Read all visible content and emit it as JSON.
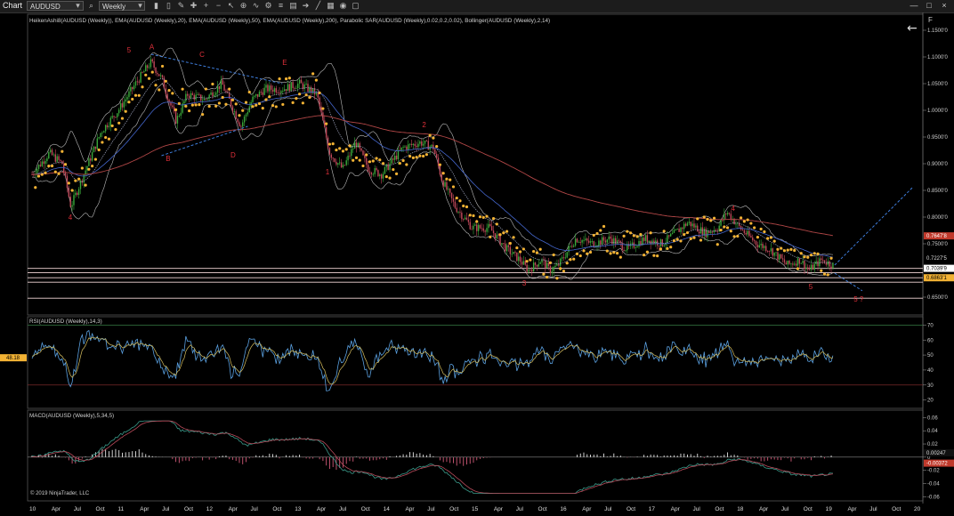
{
  "toolbar": {
    "chart_label": "Chart",
    "instrument": "AUDUSD",
    "period": "Weekly",
    "icons": [
      "search-icon",
      "instrument-dropdown-icon",
      "period-dropdown-icon",
      "bar-chart-icon",
      "candles-icon",
      "draw-icon",
      "crosshair-icon",
      "zoom-in-icon",
      "zoom-out-icon",
      "pointer-icon",
      "plus-icon",
      "indicators-icon",
      "strategy-icon",
      "properties-icon",
      "template-icon",
      "arrow-icon",
      "ruler-icon",
      "grid-icon",
      "eye-icon",
      "window-icon"
    ],
    "window_buttons": [
      "—",
      "□",
      "×"
    ],
    "back_icon": "←",
    "f_button": "F"
  },
  "colors": {
    "background": "#000000",
    "bull": "#3aa83a",
    "bear": "#c0485a",
    "sar": "#f2b234",
    "ema20": "#9aa0b8",
    "ema50": "#4466cc",
    "ema200": "#b04646",
    "boll": "#bbbbbb",
    "hline": "#f4d7d7",
    "rsi_line": "#5aa0e0",
    "rsi_signal": "#d8c060",
    "macd_line": "#3a9a8a",
    "macd_signal": "#b84a5a",
    "wave": "#e0303a",
    "projection": "#3d7bd8"
  },
  "chart_data": [
    {
      "type": "candlestick",
      "title": "HeikenAshi8(AUDUSD (Weekly)), EMA(AUDUSD (Weekly),20), EMA(AUDUSD (Weekly),50), EMA(AUDUSD (Weekly),200), Parabolic SAR(AUDUSD (Weekly),0.02,0.2,0.02), Bollinger(AUDUSD (Weekly),2,14)",
      "ylim": [
        0.62,
        1.18
      ],
      "y_ticks": [
        "1.1500'0",
        "1.1000'0",
        "1.0500'0",
        "1.0000'0",
        "0.9500'0",
        "0.9000'0",
        "0.8500'0",
        "0.8000'0",
        "0.7500'0",
        "0.6500'0"
      ],
      "y_tick_values": [
        1.15,
        1.1,
        1.05,
        1.0,
        0.95,
        0.9,
        0.85,
        0.8,
        0.75,
        0.65
      ],
      "x_ticks": [
        "10",
        "Apr",
        "Jul",
        "Oct",
        "11",
        "Apr",
        "Jul",
        "Oct",
        "12",
        "Apr",
        "Jul",
        "Oct",
        "13",
        "Apr",
        "Jul",
        "Oct",
        "14",
        "Apr",
        "Jul",
        "Oct",
        "15",
        "Apr",
        "Jul",
        "Oct",
        "16",
        "Apr",
        "Jul",
        "Oct",
        "17",
        "Apr",
        "Jul",
        "Oct",
        "18",
        "Apr",
        "Jul",
        "Oct",
        "19",
        "Apr",
        "Jul",
        "Oct",
        "20"
      ],
      "x_start": 2010.0,
      "x_end": 2020.25,
      "series_price": [
        [
          2010.0,
          0.88
        ],
        [
          2010.2,
          0.92
        ],
        [
          2010.35,
          0.9
        ],
        [
          2010.45,
          0.82
        ],
        [
          2010.6,
          0.88
        ],
        [
          2010.8,
          0.96
        ],
        [
          2011.0,
          1.0
        ],
        [
          2011.2,
          1.05
        ],
        [
          2011.33,
          1.08
        ],
        [
          2011.38,
          1.09
        ],
        [
          2011.5,
          1.06
        ],
        [
          2011.67,
          0.98
        ],
        [
          2011.8,
          1.03
        ],
        [
          2012.0,
          1.02
        ],
        [
          2012.2,
          1.05
        ],
        [
          2012.42,
          0.97
        ],
        [
          2012.55,
          1.02
        ],
        [
          2012.7,
          1.04
        ],
        [
          2012.9,
          1.04
        ],
        [
          2013.1,
          1.05
        ],
        [
          2013.3,
          1.03
        ],
        [
          2013.45,
          0.92
        ],
        [
          2013.6,
          0.89
        ],
        [
          2013.75,
          0.94
        ],
        [
          2013.9,
          0.89
        ],
        [
          2014.05,
          0.88
        ],
        [
          2014.3,
          0.93
        ],
        [
          2014.5,
          0.94
        ],
        [
          2014.65,
          0.93
        ],
        [
          2014.75,
          0.87
        ],
        [
          2014.9,
          0.82
        ],
        [
          2015.1,
          0.78
        ],
        [
          2015.3,
          0.78
        ],
        [
          2015.5,
          0.74
        ],
        [
          2015.65,
          0.72
        ],
        [
          2015.75,
          0.7
        ],
        [
          2015.9,
          0.72
        ],
        [
          2016.0,
          0.7
        ],
        [
          2016.1,
          0.71
        ],
        [
          2016.3,
          0.76
        ],
        [
          2016.5,
          0.75
        ],
        [
          2016.7,
          0.76
        ],
        [
          2016.9,
          0.74
        ],
        [
          2017.1,
          0.76
        ],
        [
          2017.3,
          0.75
        ],
        [
          2017.6,
          0.79
        ],
        [
          2017.8,
          0.77
        ],
        [
          2017.95,
          0.78
        ],
        [
          2018.05,
          0.81
        ],
        [
          2018.2,
          0.78
        ],
        [
          2018.4,
          0.75
        ],
        [
          2018.55,
          0.74
        ],
        [
          2018.75,
          0.71
        ],
        [
          2018.9,
          0.72
        ],
        [
          2019.0,
          0.7
        ],
        [
          2019.15,
          0.72
        ],
        [
          2019.28,
          0.71
        ]
      ],
      "horizontal_levels": [
        0.7039,
        0.696,
        0.6863,
        0.678,
        0.648
      ],
      "price_labels": [
        {
          "text": "0.7647'8",
          "value": 0.7648,
          "bg": "#c0392b",
          "fg": "#ffffff"
        },
        {
          "text": "0.7227'5",
          "value": 0.723,
          "bg": "#000000",
          "fg": "#dddddd"
        },
        {
          "text": "0.7039'9",
          "value": 0.704,
          "bg": "#ffffff",
          "fg": "#000000"
        },
        {
          "text": "0.6863'1",
          "value": 0.6863,
          "bg": "#f2b234",
          "fg": "#000000"
        }
      ],
      "wave_labels": [
        {
          "text": "5",
          "x": 2011.1,
          "y": 1.108
        },
        {
          "text": "A",
          "x": 2011.36,
          "y": 1.114
        },
        {
          "text": "C",
          "x": 2011.94,
          "y": 1.1
        },
        {
          "text": "E",
          "x": 2012.9,
          "y": 1.085
        },
        {
          "text": "4",
          "x": 2010.42,
          "y": 0.795
        },
        {
          "text": "B",
          "x": 2011.55,
          "y": 0.905
        },
        {
          "text": "D",
          "x": 2012.3,
          "y": 0.912
        },
        {
          "text": "1",
          "x": 2013.4,
          "y": 0.88
        },
        {
          "text": "2",
          "x": 2014.52,
          "y": 0.968
        },
        {
          "text": "3",
          "x": 2015.68,
          "y": 0.672
        },
        {
          "text": "4",
          "x": 2018.1,
          "y": 0.812
        },
        {
          "text": "5",
          "x": 2019.0,
          "y": 0.665
        },
        {
          "text": "5 ?",
          "x": 2019.52,
          "y": 0.642
        }
      ]
    },
    {
      "type": "line",
      "title": "RSI(AUDUSD (Weekly),14,3)",
      "ylim": [
        15,
        75
      ],
      "y_ticks": [
        "70",
        "60",
        "50",
        "40",
        "30",
        "20"
      ],
      "y_tick_values": [
        70,
        60,
        50,
        40,
        30,
        20
      ],
      "levels": [
        70,
        30
      ],
      "current_label": "48.18"
    },
    {
      "type": "bar",
      "title": "MACD(AUDUSD (Weekly),5,34,5)",
      "ylim": [
        -0.065,
        0.07
      ],
      "y_ticks": [
        "0.06",
        "0.04",
        "0.02",
        "0",
        "-0.02",
        "-0.04",
        "-0.06"
      ],
      "y_tick_values": [
        0.06,
        0.04,
        0.02,
        0,
        -0.02,
        -0.04,
        -0.06
      ],
      "value_labels": [
        {
          "text": "0.00247",
          "value": 0.0025,
          "bg": "#111111",
          "fg": "#dddddd"
        },
        {
          "text": "-0.00372",
          "value": -0.0037,
          "bg": "#c0392b",
          "fg": "#ffffff"
        }
      ]
    }
  ],
  "copyright": "© 2019 NinjaTrader, LLC"
}
